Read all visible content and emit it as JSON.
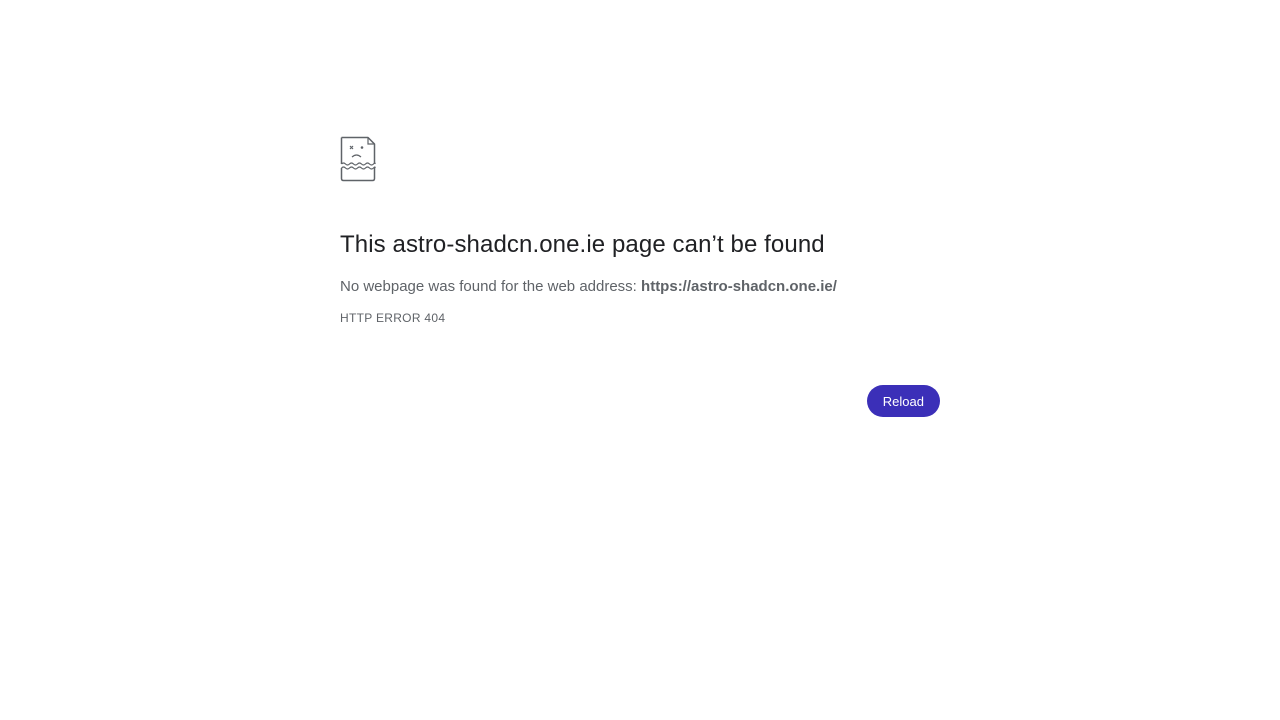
{
  "error_page": {
    "icon": "sad-document-icon",
    "title": "This astro-shadcn.one.ie page can’t be found",
    "description_prefix": "No webpage was found for the web address: ",
    "url": "https://astro-shadcn.one.ie/",
    "error_code": "HTTP ERROR 404"
  },
  "actions": {
    "reload_label": "Reload"
  },
  "colors": {
    "accent": "#3b2fb8",
    "title_text": "#202124",
    "secondary_text": "#5f6368"
  }
}
